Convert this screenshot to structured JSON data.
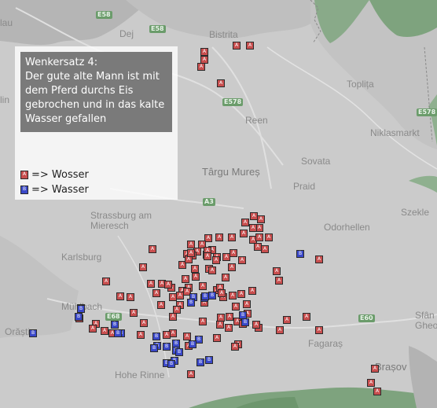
{
  "legend": {
    "title": "Wenkersatz 4:\nDer gute alte Mann ist mit dem Pferd durchs Eis gebrochen und in das kalte Wasser gefallen",
    "items": [
      {
        "code": "A",
        "label": "=> Wosser",
        "color": "#c84f4f"
      },
      {
        "code": "B",
        "label": "=> Wasser",
        "color": "#3a48c8"
      }
    ]
  },
  "places": [
    {
      "name": "lau"
    },
    {
      "name": "Dej"
    },
    {
      "name": "Bistrita"
    },
    {
      "name": "Toplița"
    },
    {
      "name": "Reen"
    },
    {
      "name": "Niklasmarkt"
    },
    {
      "name": "Târgu Mureș"
    },
    {
      "name": "Sovata"
    },
    {
      "name": "Praid"
    },
    {
      "name": "Szekle"
    },
    {
      "name": "Strassburg am Mieresch"
    },
    {
      "name": "Odorhellen"
    },
    {
      "name": "Karlsburg"
    },
    {
      "name": "Mühlbach"
    },
    {
      "name": "Orăștie"
    },
    {
      "name": "Fagaraș"
    },
    {
      "name": "Brașov"
    },
    {
      "name": "Hohe Rinne"
    },
    {
      "name": "Sfân Gheor"
    },
    {
      "name": "lin"
    }
  ],
  "road_shields": [
    "E58",
    "E58",
    "E578",
    "E578",
    "A3",
    "E60",
    "E68"
  ],
  "markers": {
    "A_count": 111,
    "B_count": 29
  }
}
